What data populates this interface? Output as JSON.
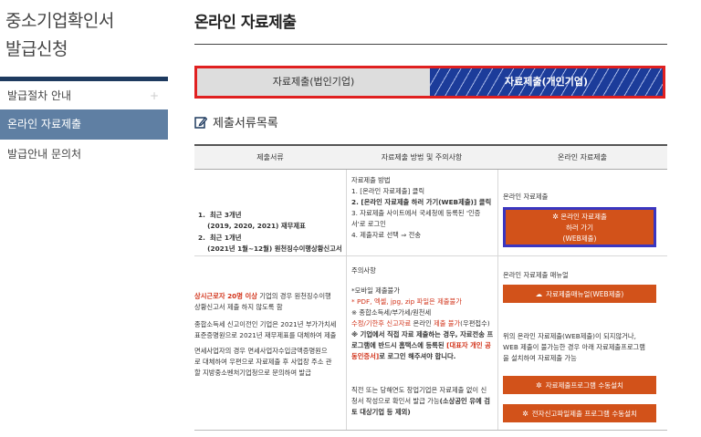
{
  "sidebar": {
    "title": "중소기업확인서\n발급신청",
    "items": [
      {
        "label": "발급절차 안내",
        "plus": "+"
      },
      {
        "label": "온라인 자료제출"
      },
      {
        "label": "발급안내 문의처"
      }
    ]
  },
  "main": {
    "title": "온라인 자료제출",
    "tabs": [
      "자료제출(법인기업)",
      "자료제출(개인기업)"
    ],
    "section_title": "제출서류목록",
    "table": {
      "headers": [
        "제출서류",
        "자료제출 방법 및 주의사항",
        "온라인 자료제출"
      ],
      "docs": {
        "item1_num": "1.",
        "item1": "최근 3개년",
        "item1_sub": "(2019, 2020, 2021) 재무제표",
        "item2_num": "2.",
        "item2": "최근 1개년",
        "item2_sub": "(2021년 1월~12월) 원천징수이행상황신고서",
        "note_red": "상시근로자 20명 이상",
        "note_1": " 기업의 경우 원천징수이행",
        "note_2": "상황신고서 제출 하지 않도록 함",
        "note_3": "종합소득세 신고이전인 기업은 2021년 부가가치세",
        "note_4": "표준증명원으로 2021년 재무제표를 대체하여 제출",
        "note_5": "면세사업자의 경우 면세사업자수입금액증명원으",
        "note_6": "로 대체하여 우편으로 자료제출 후 사업장 주소 관",
        "note_7": "할 지방중소벤처기업청으로 문의하여 발급"
      },
      "method": {
        "heading": "자료제출 방법",
        "step1": "1.  [온라인 자료제출] 클릭",
        "step2": "2.  [온라인 자료제출 하러 가기(WEB제출)] 클릭",
        "step3a": "3.  자료제출 사이트에서 국세청에 등록된 '인증",
        "step3b": "     서'로 로그인",
        "step4": "4.  제출자료 선택 ⇒ 전송",
        "caution_heading": "주의사항",
        "c1": "*모바일 제출불가",
        "c2": "* PDF, 엑셀, jpg, zip 파일은 제출불가",
        "c3": "※ 종합소득세/부가세/원천세",
        "c4_a": "수정/기한후 신고자료",
        "c4_b": " 온라인 ",
        "c4_c": "제출 불가",
        "c4_d": "(우편접수)",
        "c5": "※ 기업에서 직접 자료 제출하는 경우, 자료전송 프",
        "c6_a": "로그램에 반드시 홈택스에 등록된 ",
        "c6_b": "[대표자 개인 공",
        "c7_a": "동인증서]",
        "c7_b": "로 로그인 해주셔야 합니다.",
        "c8": "직전 또는 당해연도 창업기업은 자료제출 없이 신",
        "c9_a": "청서 작성으로 확인서 발급 가능",
        "c9_b": "(소상공인 유예 검",
        "c10": "토 대상기업 등 제외)"
      },
      "online": {
        "label1": "온라인 자료제출",
        "btn_web_line1": "온라인 자료제출",
        "btn_web_line2": "하러 가기",
        "btn_web_line3": "(WEB제출)",
        "label2": "온라인 자료제출 매뉴얼",
        "btn_manual": "자료제출매뉴얼(WEB제출)",
        "desc1": "위의 온라인 자료제출(WEB제출)이 되지않거나,",
        "desc2": "WEB 제출이 불가능한 경우 아래 자료제출프로그램",
        "desc3": "을 설치하여 자료제출 가능",
        "btn_install": "자료제출프로그램 수동설치",
        "btn_tax": "전자신고파일제출 프로그램 수동설치"
      }
    }
  },
  "colors": {
    "accent": "#d2521a",
    "nav_active": "#5f7fa3",
    "tab_active": "#1c3c9a",
    "highlight": "#e02020"
  }
}
